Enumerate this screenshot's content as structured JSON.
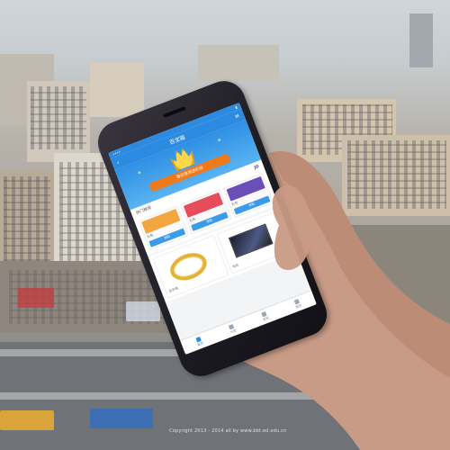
{
  "scene": {
    "copyright": "Copyright 2013 - 2014 all by www.bbt.ed.edu.cn"
  },
  "phone": {
    "status_bar": {
      "carrier": "••••",
      "time": "",
      "battery": ""
    },
    "nav": {
      "title": "百宝箱",
      "back_icon": "chevron-left-icon",
      "menu_icon": "menu-icon"
    },
    "banner": {
      "ribbon_text": "每日签到送红包"
    },
    "section": {
      "title": "热门推荐",
      "more": "JD"
    },
    "cards": [
      {
        "title": "礼包",
        "btn": "领取"
      },
      {
        "title": "礼包",
        "btn": "领取"
      },
      {
        "title": "礼包",
        "btn": "领取"
      }
    ],
    "products": [
      {
        "caption": "金手镯"
      },
      {
        "caption": "电视"
      }
    ],
    "tabs": [
      {
        "label": "首页"
      },
      {
        "label": "分类"
      },
      {
        "label": "发现"
      },
      {
        "label": "我的"
      }
    ]
  },
  "colors": {
    "accent": "#2c8be0",
    "orange": "#f07a1a",
    "gold": "#e3b339"
  }
}
